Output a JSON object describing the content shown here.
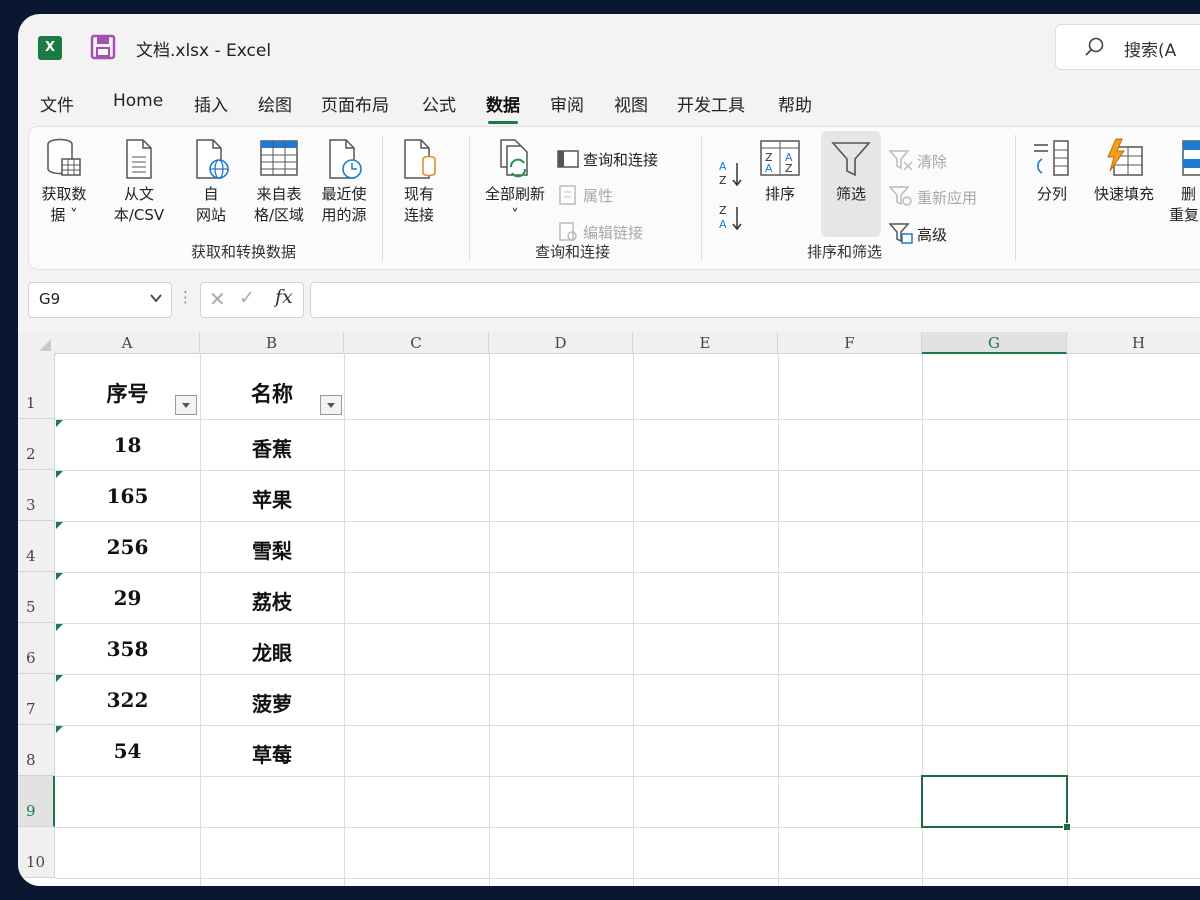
{
  "window": {
    "title": "文档.xlsx  -  Excel",
    "search_placeholder": "搜索(A"
  },
  "tabs": [
    "文件",
    "Home",
    "插入",
    "绘图",
    "页面布局",
    "公式",
    "数据",
    "审阅",
    "视图",
    "开发工具",
    "帮助"
  ],
  "active_tab": "数据",
  "ribbon": {
    "get_data_line1": "获取数",
    "get_data_line2": "据 ˅",
    "from_text_line1": "从文",
    "from_text_line2": "本/CSV",
    "from_web_line1": "自",
    "from_web_line2": "网站",
    "from_table_line1": "来自表",
    "from_table_line2": "格/区域",
    "recent_line1": "最近使",
    "recent_line2": "用的源",
    "existing_line1": "现有",
    "existing_line2": "连接",
    "group1_label": "获取和转换数据",
    "refresh_line1": "全部刷新",
    "refresh_line2": "˅",
    "queries_connections": "查询和连接",
    "properties": "属性",
    "edit_links": "编辑链接",
    "group2_label": "查询和连接",
    "sort": "排序",
    "filter": "筛选",
    "clear": "清除",
    "reapply": "重新应用",
    "advanced": "高级",
    "group3_label": "排序和筛选",
    "text_to_columns": "分列",
    "flash_fill": "快速填充",
    "remove_dup_line1": "删",
    "remove_dup_line2": "重复"
  },
  "formula_bar": {
    "name_box": "G9",
    "fx": "fx",
    "formula": ""
  },
  "sheet": {
    "columns": [
      "A",
      "B",
      "C",
      "D",
      "E",
      "F",
      "G",
      "H"
    ],
    "rows": [
      "1",
      "2",
      "3",
      "4",
      "5",
      "6",
      "7",
      "8",
      "9",
      "10"
    ],
    "selected_cell": "G9",
    "header": [
      "序号",
      "名称"
    ],
    "data": [
      [
        "18",
        "香蕉"
      ],
      [
        "165",
        "苹果"
      ],
      [
        "256",
        "雪梨"
      ],
      [
        "29",
        "荔枝"
      ],
      [
        "358",
        "龙眼"
      ],
      [
        "322",
        "菠萝"
      ],
      [
        "54",
        "草莓"
      ]
    ]
  },
  "colors": {
    "accent": "#1d7a44",
    "background": "#0b1630"
  }
}
